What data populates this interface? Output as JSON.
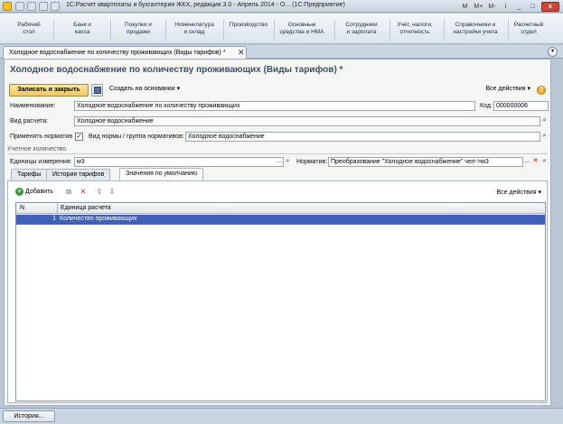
{
  "window": {
    "title": "1С:Расчет квартплаты и бухгалтерия ЖКХ, редакция 3.0 - Апрель 2014 - О...   (1С:Предприятие)",
    "right_buttons": [
      "M",
      "M+",
      "M-",
      "i",
      "_",
      "□"
    ],
    "close_label": "x"
  },
  "sections": [
    {
      "line1": "Рабочий",
      "line2": "стол"
    },
    {
      "line1": "Банк и",
      "line2": "касса"
    },
    {
      "line1": "Покупки и",
      "line2": "продажи"
    },
    {
      "line1": "Номенклатура",
      "line2": "и склад"
    },
    {
      "line1": "Производство",
      "line2": ""
    },
    {
      "line1": "Основные",
      "line2": "средства и НМА"
    },
    {
      "line1": "Сотрудники",
      "line2": "и зарплата"
    },
    {
      "line1": "Учет, налоги,",
      "line2": "отчетность"
    },
    {
      "line1": "Справочники и",
      "line2": "настройки учета"
    },
    {
      "line1": "Расчетный",
      "line2": "отдел"
    }
  ],
  "doc_tab": {
    "label": "Холодное водоснабжение по количеству проживающих (Виды тарифов) *"
  },
  "form": {
    "title": "Холодное водоснабжение по количеству проживающих (Виды тарифов) *",
    "toolbar": {
      "save_close": "Записать и закрыть",
      "create_based": "Создать на основании ▾",
      "all_actions": "Все действия ▾"
    },
    "fields": {
      "name_label": "Наименование:",
      "name_value": "Холодное водоснабжение по количеству проживающих",
      "code_label": "Код:",
      "code_value": "000000006",
      "calc_label": "Вид расчета:",
      "calc_value": "Холодное водоснабжение",
      "apply_norm_label": "Применять норматив",
      "norm_type_label": "Вид нормы / группа нормативов:",
      "norm_type_value": "Холодное водоснабжение",
      "group_label": "Учетное количество",
      "units_label": "Единицы измерения:",
      "units_value": "м3",
      "normative_label": "Норматив:",
      "normative_value": "Преобразование \"Холодное водоснабжение\" чел->м3"
    },
    "tabs": [
      "Тарифы",
      "История тарифов",
      "Значения по умолчанию"
    ],
    "table": {
      "add_label": "Добавить",
      "all_actions": "Все действия ▾",
      "columns": [
        "N",
        "Единица расчета"
      ],
      "rows": [
        {
          "n": "1",
          "unit": "Количество проживающих"
        }
      ]
    }
  },
  "bottom": {
    "history": "История..."
  }
}
